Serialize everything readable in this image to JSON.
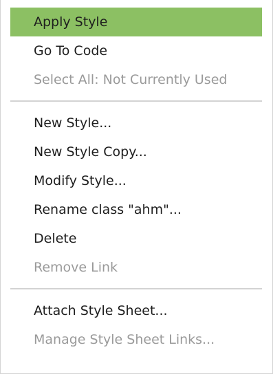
{
  "context_menu": {
    "highlight_color": "#8cc063",
    "groups": [
      {
        "items": [
          {
            "label": "Apply Style",
            "state": "highlighted"
          },
          {
            "label": "Go To Code",
            "state": "enabled"
          },
          {
            "label": "Select All: Not Currently Used",
            "state": "disabled"
          }
        ]
      },
      {
        "items": [
          {
            "label": "New Style...",
            "state": "enabled"
          },
          {
            "label": "New Style Copy...",
            "state": "enabled"
          },
          {
            "label": "Modify Style...",
            "state": "enabled"
          },
          {
            "label": "Rename class \"ahm\"...",
            "state": "enabled"
          },
          {
            "label": "Delete",
            "state": "enabled"
          },
          {
            "label": "Remove Link",
            "state": "disabled"
          }
        ]
      },
      {
        "items": [
          {
            "label": "Attach Style Sheet...",
            "state": "enabled"
          },
          {
            "label": "Manage Style Sheet Links...",
            "state": "disabled"
          }
        ]
      }
    ]
  }
}
